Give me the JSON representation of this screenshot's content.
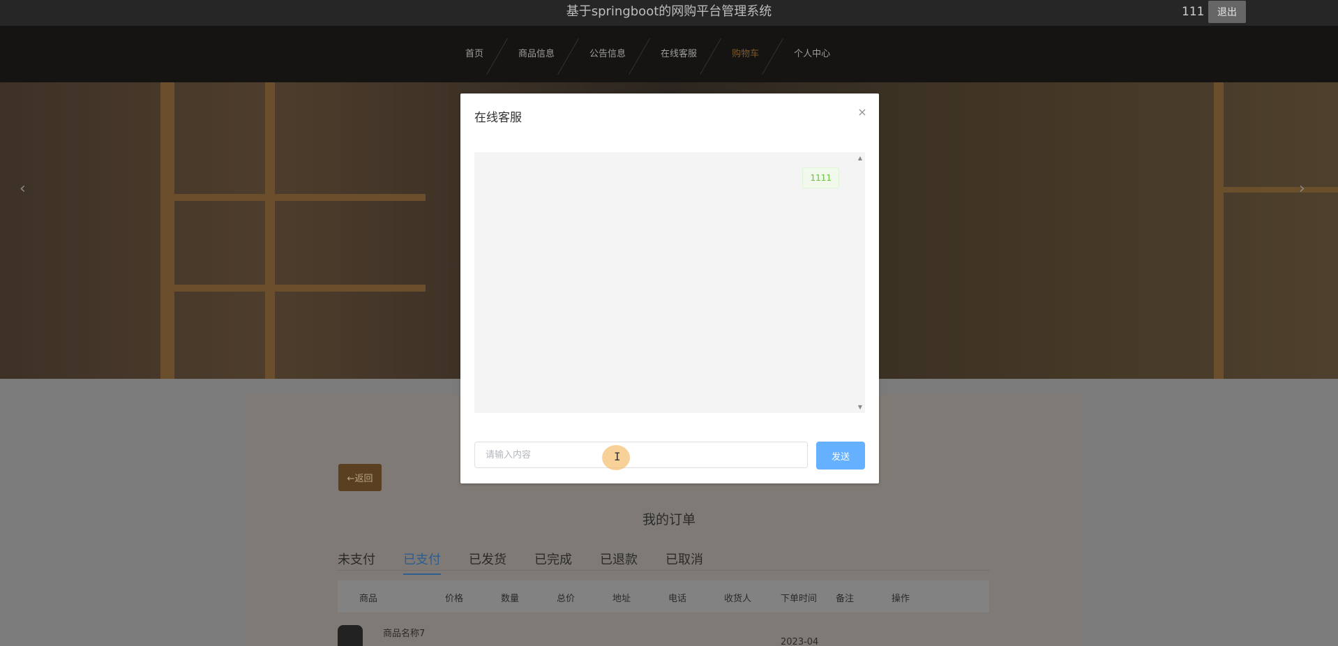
{
  "header": {
    "site_title": "基于springboot的网购平台管理系统",
    "user_name": "111",
    "logout_label": "退出"
  },
  "nav": {
    "items": [
      {
        "label": "首页"
      },
      {
        "label": "商品信息"
      },
      {
        "label": "公告信息"
      },
      {
        "label": "在线客服"
      },
      {
        "label": "购物车",
        "active": true
      },
      {
        "label": "个人中心"
      }
    ]
  },
  "banner": {
    "prev_icon": "chevron-left-icon",
    "next_icon": "chevron-right-icon",
    "prev_glyph": "‹",
    "next_glyph": "›"
  },
  "dialog": {
    "title": "在线客服",
    "close_glyph": "×",
    "messages": [
      {
        "text": "1111",
        "side": "right"
      }
    ],
    "input_placeholder": "请输入内容",
    "input_value": "",
    "send_label": "发送"
  },
  "orders": {
    "back_label": "←返回",
    "title": "我的订单",
    "tabs": [
      {
        "label": "未支付"
      },
      {
        "label": "已支付",
        "active": true
      },
      {
        "label": "已发货"
      },
      {
        "label": "已完成"
      },
      {
        "label": "已退款"
      },
      {
        "label": "已取消"
      }
    ],
    "columns": [
      "商品",
      "价格",
      "数量",
      "总价",
      "地址",
      "电话",
      "收货人",
      "下单时间",
      "备注",
      "操作"
    ],
    "rows": [
      {
        "name": "商品名称7",
        "date": "2023-04"
      }
    ]
  },
  "colors": {
    "dialog_bg": "#ffffff",
    "send_button": "#66b1ff",
    "bubble_text": "#67c23a",
    "active_nav": "#7a5a2f",
    "active_tab": "#2e5d8f"
  }
}
